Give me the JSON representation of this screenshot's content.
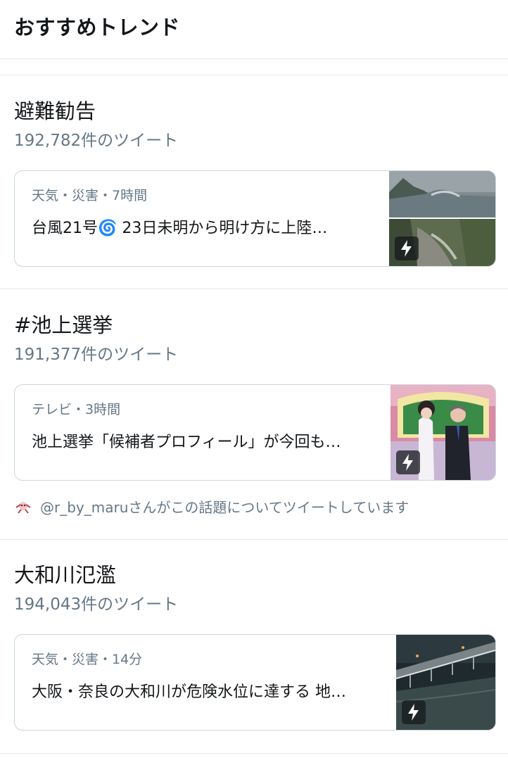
{
  "header": {
    "title": "おすすめトレンド"
  },
  "trends": [
    {
      "name": "避難勧告",
      "tweet_count": "192,782件のツイート",
      "card": {
        "meta": "天気・災害・7時間",
        "headline": "台風21号🌀 23日未明から明け方に上陸…"
      }
    },
    {
      "name": "#池上選挙",
      "tweet_count": "191,377件のツイート",
      "card": {
        "meta": "テレビ・3時間",
        "headline": "池上選挙「候補者プロフィール」が今回も…"
      },
      "mention": {
        "user": "@r_by_maru",
        "text": "さんがこの話題についてツイートしています"
      }
    },
    {
      "name": "大和川氾濫",
      "tweet_count": "194,043件のツイート",
      "card": {
        "meta": "天気・災害・14分",
        "headline": "大阪・奈良の大和川が危険水位に達する 地…"
      }
    }
  ],
  "colors": {
    "primary_text": "#14171a",
    "secondary_text": "#657786",
    "border": "#e1e8ed"
  },
  "icons": [
    "lightning-icon",
    "avatar-icon"
  ]
}
